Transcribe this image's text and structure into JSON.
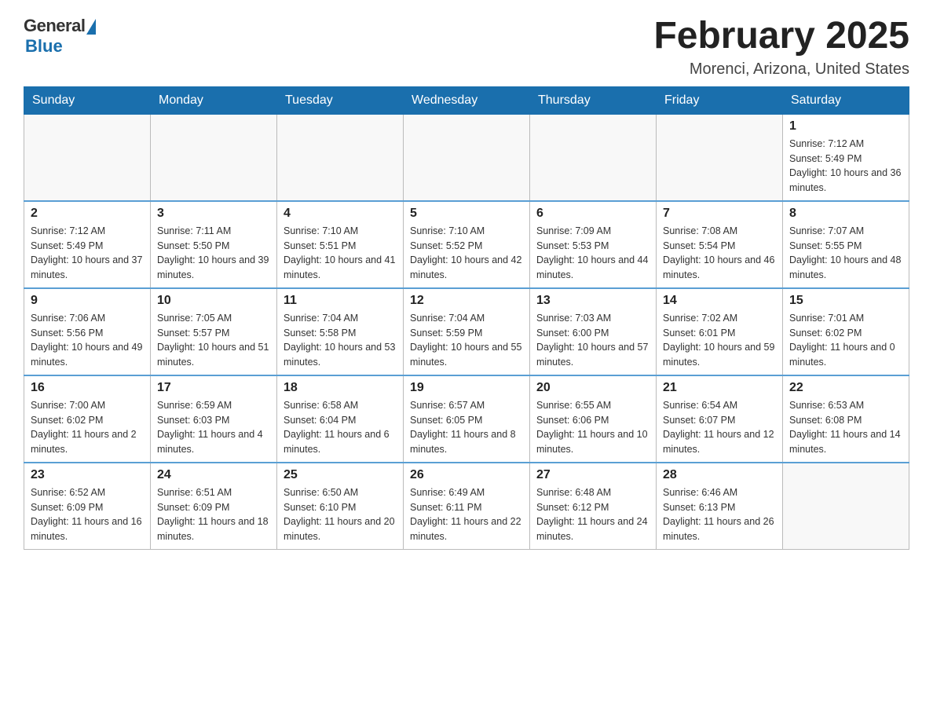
{
  "header": {
    "logo_general": "General",
    "logo_blue": "Blue",
    "month_title": "February 2025",
    "location": "Morenci, Arizona, United States"
  },
  "days_of_week": [
    "Sunday",
    "Monday",
    "Tuesday",
    "Wednesday",
    "Thursday",
    "Friday",
    "Saturday"
  ],
  "weeks": [
    {
      "days": [
        {
          "number": "",
          "empty": true
        },
        {
          "number": "",
          "empty": true
        },
        {
          "number": "",
          "empty": true
        },
        {
          "number": "",
          "empty": true
        },
        {
          "number": "",
          "empty": true
        },
        {
          "number": "",
          "empty": true
        },
        {
          "number": "1",
          "sunrise": "Sunrise: 7:12 AM",
          "sunset": "Sunset: 5:49 PM",
          "daylight": "Daylight: 10 hours and 36 minutes."
        }
      ]
    },
    {
      "days": [
        {
          "number": "2",
          "sunrise": "Sunrise: 7:12 AM",
          "sunset": "Sunset: 5:49 PM",
          "daylight": "Daylight: 10 hours and 37 minutes."
        },
        {
          "number": "3",
          "sunrise": "Sunrise: 7:11 AM",
          "sunset": "Sunset: 5:50 PM",
          "daylight": "Daylight: 10 hours and 39 minutes."
        },
        {
          "number": "4",
          "sunrise": "Sunrise: 7:10 AM",
          "sunset": "Sunset: 5:51 PM",
          "daylight": "Daylight: 10 hours and 41 minutes."
        },
        {
          "number": "5",
          "sunrise": "Sunrise: 7:10 AM",
          "sunset": "Sunset: 5:52 PM",
          "daylight": "Daylight: 10 hours and 42 minutes."
        },
        {
          "number": "6",
          "sunrise": "Sunrise: 7:09 AM",
          "sunset": "Sunset: 5:53 PM",
          "daylight": "Daylight: 10 hours and 44 minutes."
        },
        {
          "number": "7",
          "sunrise": "Sunrise: 7:08 AM",
          "sunset": "Sunset: 5:54 PM",
          "daylight": "Daylight: 10 hours and 46 minutes."
        },
        {
          "number": "8",
          "sunrise": "Sunrise: 7:07 AM",
          "sunset": "Sunset: 5:55 PM",
          "daylight": "Daylight: 10 hours and 48 minutes."
        }
      ]
    },
    {
      "days": [
        {
          "number": "9",
          "sunrise": "Sunrise: 7:06 AM",
          "sunset": "Sunset: 5:56 PM",
          "daylight": "Daylight: 10 hours and 49 minutes."
        },
        {
          "number": "10",
          "sunrise": "Sunrise: 7:05 AM",
          "sunset": "Sunset: 5:57 PM",
          "daylight": "Daylight: 10 hours and 51 minutes."
        },
        {
          "number": "11",
          "sunrise": "Sunrise: 7:04 AM",
          "sunset": "Sunset: 5:58 PM",
          "daylight": "Daylight: 10 hours and 53 minutes."
        },
        {
          "number": "12",
          "sunrise": "Sunrise: 7:04 AM",
          "sunset": "Sunset: 5:59 PM",
          "daylight": "Daylight: 10 hours and 55 minutes."
        },
        {
          "number": "13",
          "sunrise": "Sunrise: 7:03 AM",
          "sunset": "Sunset: 6:00 PM",
          "daylight": "Daylight: 10 hours and 57 minutes."
        },
        {
          "number": "14",
          "sunrise": "Sunrise: 7:02 AM",
          "sunset": "Sunset: 6:01 PM",
          "daylight": "Daylight: 10 hours and 59 minutes."
        },
        {
          "number": "15",
          "sunrise": "Sunrise: 7:01 AM",
          "sunset": "Sunset: 6:02 PM",
          "daylight": "Daylight: 11 hours and 0 minutes."
        }
      ]
    },
    {
      "days": [
        {
          "number": "16",
          "sunrise": "Sunrise: 7:00 AM",
          "sunset": "Sunset: 6:02 PM",
          "daylight": "Daylight: 11 hours and 2 minutes."
        },
        {
          "number": "17",
          "sunrise": "Sunrise: 6:59 AM",
          "sunset": "Sunset: 6:03 PM",
          "daylight": "Daylight: 11 hours and 4 minutes."
        },
        {
          "number": "18",
          "sunrise": "Sunrise: 6:58 AM",
          "sunset": "Sunset: 6:04 PM",
          "daylight": "Daylight: 11 hours and 6 minutes."
        },
        {
          "number": "19",
          "sunrise": "Sunrise: 6:57 AM",
          "sunset": "Sunset: 6:05 PM",
          "daylight": "Daylight: 11 hours and 8 minutes."
        },
        {
          "number": "20",
          "sunrise": "Sunrise: 6:55 AM",
          "sunset": "Sunset: 6:06 PM",
          "daylight": "Daylight: 11 hours and 10 minutes."
        },
        {
          "number": "21",
          "sunrise": "Sunrise: 6:54 AM",
          "sunset": "Sunset: 6:07 PM",
          "daylight": "Daylight: 11 hours and 12 minutes."
        },
        {
          "number": "22",
          "sunrise": "Sunrise: 6:53 AM",
          "sunset": "Sunset: 6:08 PM",
          "daylight": "Daylight: 11 hours and 14 minutes."
        }
      ]
    },
    {
      "days": [
        {
          "number": "23",
          "sunrise": "Sunrise: 6:52 AM",
          "sunset": "Sunset: 6:09 PM",
          "daylight": "Daylight: 11 hours and 16 minutes."
        },
        {
          "number": "24",
          "sunrise": "Sunrise: 6:51 AM",
          "sunset": "Sunset: 6:09 PM",
          "daylight": "Daylight: 11 hours and 18 minutes."
        },
        {
          "number": "25",
          "sunrise": "Sunrise: 6:50 AM",
          "sunset": "Sunset: 6:10 PM",
          "daylight": "Daylight: 11 hours and 20 minutes."
        },
        {
          "number": "26",
          "sunrise": "Sunrise: 6:49 AM",
          "sunset": "Sunset: 6:11 PM",
          "daylight": "Daylight: 11 hours and 22 minutes."
        },
        {
          "number": "27",
          "sunrise": "Sunrise: 6:48 AM",
          "sunset": "Sunset: 6:12 PM",
          "daylight": "Daylight: 11 hours and 24 minutes."
        },
        {
          "number": "28",
          "sunrise": "Sunrise: 6:46 AM",
          "sunset": "Sunset: 6:13 PM",
          "daylight": "Daylight: 11 hours and 26 minutes."
        },
        {
          "number": "",
          "empty": true
        }
      ]
    }
  ]
}
